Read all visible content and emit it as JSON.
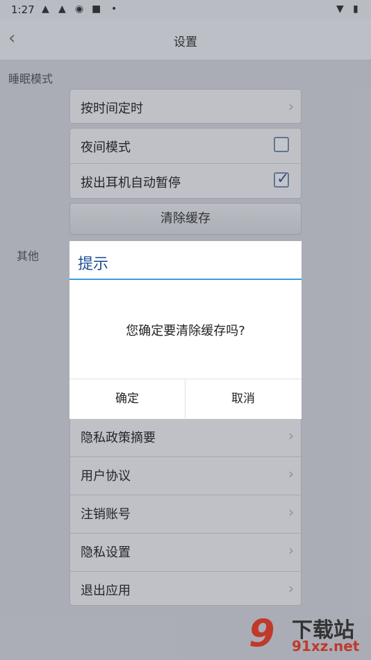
{
  "status_bar": {
    "time": "1:27",
    "icons": [
      "qq-icon",
      "qq-icon",
      "weibo-icon",
      "square-icon",
      "dot-icon",
      "wifi-icon",
      "battery-icon"
    ]
  },
  "header": {
    "title": "设置"
  },
  "sleep_section": {
    "label": "睡眠模式"
  },
  "timer_row": {
    "label": "按时间定时"
  },
  "toggles": [
    {
      "label": "夜间模式",
      "checked": false
    },
    {
      "label": "拔出耳机自动暂停",
      "checked": true
    }
  ],
  "clear_cache_button": {
    "label": "清除缓存"
  },
  "other_section": {
    "label": "其他"
  },
  "other_items": [
    {
      "label": "隐私政策摘要"
    },
    {
      "label": "用户协议"
    },
    {
      "label": "注销账号"
    },
    {
      "label": "隐私设置"
    },
    {
      "label": "退出应用"
    }
  ],
  "dialog": {
    "title": "提示",
    "message": "您确定要清除缓存吗?",
    "confirm_label": "确定",
    "cancel_label": "取消"
  },
  "watermark": {
    "brand": "9",
    "text": "下载站",
    "url": "91xz.net"
  }
}
